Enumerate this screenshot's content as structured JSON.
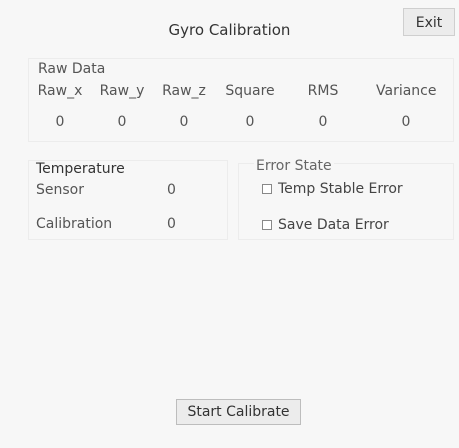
{
  "window": {
    "title": "Gyro Calibration",
    "exit_label": "Exit"
  },
  "raw_data": {
    "title": "Raw Data",
    "columns": [
      {
        "label": "Raw_x",
        "value": "0"
      },
      {
        "label": "Raw_y",
        "value": "0"
      },
      {
        "label": "Raw_z",
        "value": "0"
      },
      {
        "label": "Square",
        "value": "0"
      },
      {
        "label": "RMS",
        "value": "0"
      },
      {
        "label": "Variance",
        "value": "0"
      }
    ]
  },
  "temperature": {
    "title": "Temperature",
    "sensor_label": "Sensor",
    "sensor_value": "0",
    "calibration_label": "Calibration",
    "calibration_value": "0"
  },
  "error_state": {
    "title": "Error State",
    "temp_stable_error": {
      "label": "Temp Stable Error",
      "checked": false
    },
    "save_data_error": {
      "label": "Save Data Error",
      "checked": false
    }
  },
  "actions": {
    "start_calibrate_label": "Start Calibrate"
  }
}
